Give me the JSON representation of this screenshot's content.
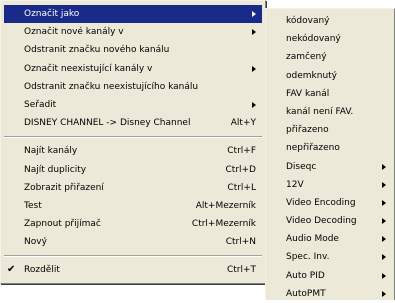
{
  "main_menu": {
    "groups": [
      [
        {
          "label": "Označit jako",
          "submenu": true,
          "selected": true
        },
        {
          "label": "Označit nové kanály v",
          "submenu": true
        },
        {
          "label": "Odstranit značku nového kanálu"
        },
        {
          "label": "Označit neexistující kanály v",
          "submenu": true
        },
        {
          "label": "Odstranit značku neexistujícího kanálu"
        },
        {
          "label": "Seřadit",
          "submenu": true
        },
        {
          "label": "DISNEY CHANNEL -> Disney Channel",
          "shortcut": "Alt+Y"
        }
      ],
      [
        {
          "label": "Najít kanály",
          "shortcut": "Ctrl+F"
        },
        {
          "label": "Najít duplicity",
          "shortcut": "Ctrl+D"
        },
        {
          "label": "Zobrazit přiřazení",
          "shortcut": "Ctrl+L"
        },
        {
          "label": "Test",
          "shortcut": "Alt+Mezerník"
        },
        {
          "label": "Zapnout přijímač",
          "shortcut": "Ctrl+Mezerník"
        },
        {
          "label": "Nový",
          "shortcut": "Ctrl+N"
        }
      ],
      [
        {
          "label": "Rozdělit",
          "shortcut": "Ctrl+T",
          "checked": true,
          "check_glyph": "✔"
        }
      ]
    ]
  },
  "sub_menu": {
    "items": [
      {
        "label": "kódovaný"
      },
      {
        "label": "nekódovaný"
      },
      {
        "label": "zamčený"
      },
      {
        "label": "odemknutý"
      },
      {
        "label": "FAV kanál"
      },
      {
        "label": "kanál není FAV."
      },
      {
        "label": "přiřazeno"
      },
      {
        "label": "nepřiřazeno"
      },
      {
        "label": "Diseqc",
        "submenu": true
      },
      {
        "label": "12V",
        "submenu": true
      },
      {
        "label": "Video Encoding",
        "submenu": true
      },
      {
        "label": "Video Decoding",
        "submenu": true
      },
      {
        "label": "Audio Mode",
        "submenu": true
      },
      {
        "label": "Spec. Inv.",
        "submenu": true
      },
      {
        "label": "Auto PID",
        "submenu": true
      },
      {
        "label": "AutoPMT",
        "submenu": true
      }
    ]
  },
  "colors": {
    "menu_background": "#ece9d8",
    "selection_background": "#1a2a88",
    "selection_text": "#ffffff"
  }
}
